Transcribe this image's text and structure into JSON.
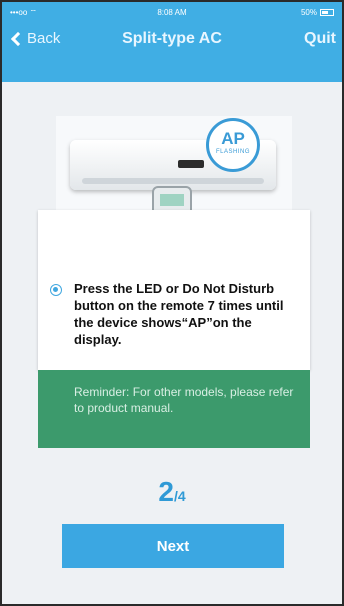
{
  "status_bar": {
    "carrier": "•••oo ⌔",
    "time": "8:08 AM",
    "battery": "50%"
  },
  "nav": {
    "back_label": "Back",
    "title": "Split-type AC",
    "quit_label": "Quit"
  },
  "illustration": {
    "badge_main": "AP",
    "badge_sub": "FLASHING"
  },
  "instruction": {
    "text": "Press the LED or Do Not Disturb button on the remote 7 times until the device shows“AP”on the display."
  },
  "reminder": {
    "text": "Reminder: For other models, please refer to product manual."
  },
  "step": {
    "current": "2",
    "separator": "/",
    "total": "4"
  },
  "next_button": {
    "label": "Next"
  },
  "colors": {
    "header": "#40aee4",
    "accent": "#3ba7e2",
    "reminder_bg": "#3c9a6c"
  }
}
